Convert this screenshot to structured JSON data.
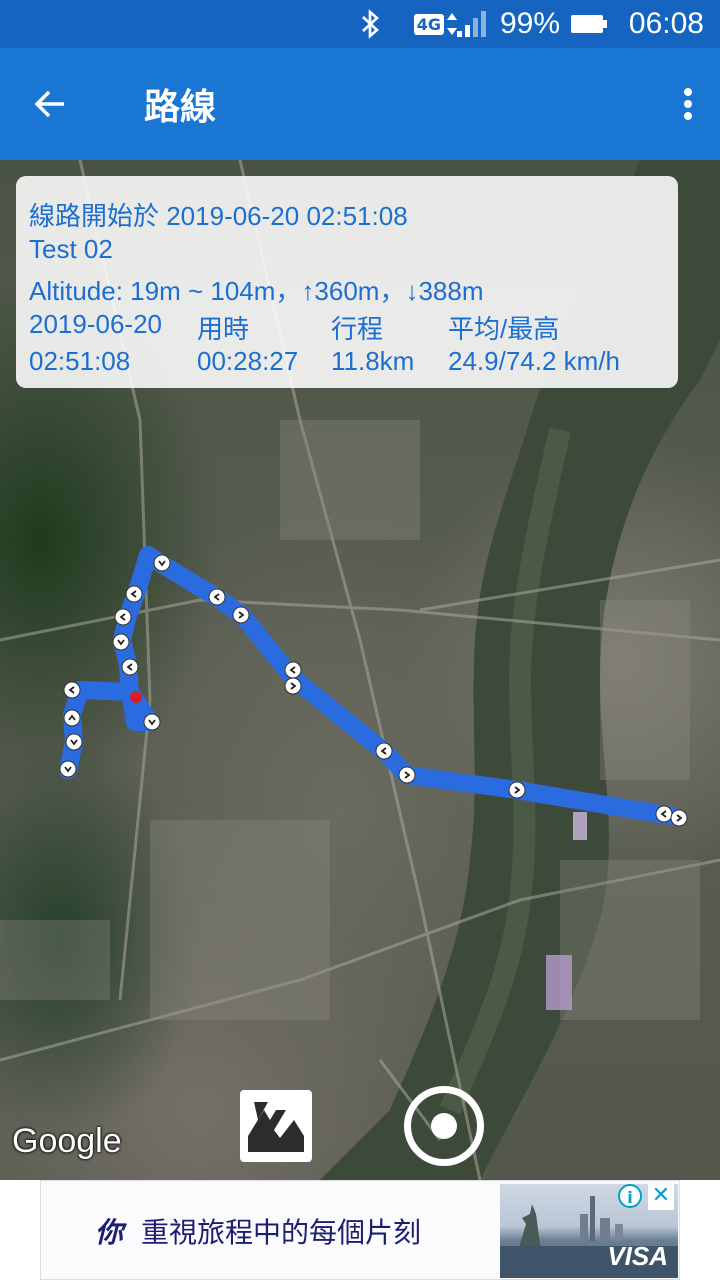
{
  "status_bar": {
    "network": "4G",
    "battery": "99%",
    "time": "06:08",
    "icons": [
      "bluetooth-icon",
      "network-4g-icon",
      "signal-icon",
      "battery-icon"
    ]
  },
  "app_bar": {
    "title": "路線",
    "back_icon": "arrow-back-icon",
    "menu_icon": "more-vert-icon"
  },
  "info": {
    "start_label": "線路開始於 2019-06-20 02:51:08",
    "name": "Test 02",
    "altitude": "Altitude: 19m ~ 104m，↑360m，↓388m",
    "headers": [
      "2019-06-20",
      "用時",
      "行程",
      "平均/最高"
    ],
    "values": [
      "02:51:08",
      "00:28:27",
      "11.8km",
      "24.9/74.2 km/h"
    ]
  },
  "map": {
    "attribution": "Google",
    "route_color": "#2b6be0",
    "marker_color": "#d4202a"
  },
  "controls": {
    "gallery_icon": "image-icon",
    "record_icon": "record-icon"
  },
  "ad": {
    "lead": "你",
    "text": "重視旅程中的每個片刻",
    "brand": "VISA",
    "info_icon": "ⓘ",
    "close_icon": "✕"
  },
  "colors": {
    "status_bar": "#1565c0",
    "app_bar": "#1976d2",
    "info_text": "#1c6fd1"
  }
}
